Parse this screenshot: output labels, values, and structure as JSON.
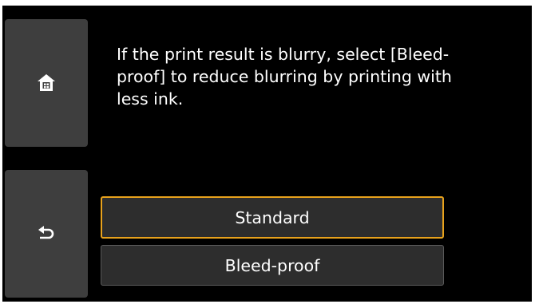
{
  "message": "If the print result is blurry, select [Bleed-proof] to reduce blurring by printing with less ink.",
  "side": {
    "home_icon": "home-icon",
    "back_icon": "back-arrow-icon"
  },
  "options": [
    {
      "label": "Standard",
      "selected": true
    },
    {
      "label": "Bleed-proof",
      "selected": false
    }
  ],
  "colors": {
    "background": "#000000",
    "button": "#3e3e3e",
    "option": "#2d2d2d",
    "selected_border": "#e8a21c"
  }
}
